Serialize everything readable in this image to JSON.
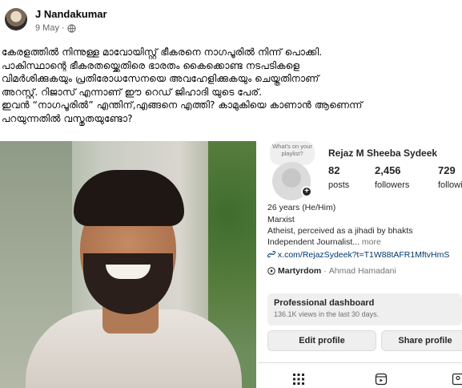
{
  "post": {
    "author": "J Nandakumar",
    "date": "9 May",
    "separator": "·",
    "privacy_icon": "globe-icon",
    "text_lines": [
      "കേരളത്തിൽ നിന്നുള്ള മാവോയിസ്റ്റ് ഭീകരനെ നാഗപൂരിൽ നിന്ന് പൊക്കി.",
      "പാകിസ്ഥാന്റെ ഭീകരതയ്ക്കെതിരെ ഭാരതം കൈക്കൊണ്ട നടപടികളെ",
      "വിമർശിക്കുകയും പ്രതിരോധസേനയെ അവഹേളിക്കുകയും ചെയ്തതിനാണ്",
      "അറസ്റ്റ്. റിജാസ് എന്നാണ് ഈ റെഡ് ജിഹാദി യുടെ പേര്.",
      "ഇവൻ “നാഗപൂരിൽ” എന്തിന്,എങ്ങനെ എത്തി? കാമുകിയെ കാണാൻ ആണെന്ന്",
      "പറയുന്നതിൽ വസ്തുതയുണ്ടോ?"
    ]
  },
  "instagram": {
    "note_bubble": "What's on your playlist?",
    "username": "Rejaz M Sheeba Sydeek",
    "stats": [
      {
        "value": "82",
        "label": "posts"
      },
      {
        "value": "2,456",
        "label": "followers"
      },
      {
        "value": "729",
        "label": "following"
      }
    ],
    "bio": {
      "age_pronouns": "26 years (He/Him)",
      "line2": "Marxist",
      "line3": "Atheist, perceived as a jihadi by bhakts",
      "line4": "Independent Journalist...",
      "more": " more",
      "link": "x.com/RejazSydeek?t=T1W88tAFR1MftvHmS",
      "music_title": "Martyrdom",
      "music_sep": " · ",
      "music_artist": "Ahmad Hamadani"
    },
    "dashboard": {
      "title": "Professional dashboard",
      "subtitle": "136.1K views in the last 30 days."
    },
    "buttons": {
      "edit_profile": "Edit profile",
      "share_profile": "Share profile"
    },
    "tabs": [
      "grid-icon",
      "reels-icon",
      "tagged-icon"
    ]
  },
  "colors": {
    "text": "#050505",
    "muted": "#65676b",
    "ig_link": "#00376b",
    "ig_button": "#efefef"
  }
}
